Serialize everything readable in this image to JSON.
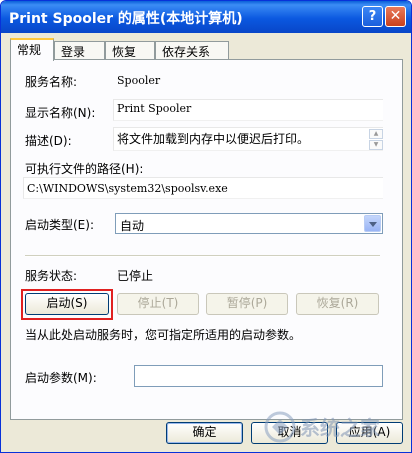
{
  "window": {
    "title": "Print Spooler 的属性(本地计算机)",
    "help_label": "?",
    "close_label": "✕"
  },
  "tabs": [
    {
      "label": "常规",
      "active": true
    },
    {
      "label": "登录",
      "active": false
    },
    {
      "label": "恢复",
      "active": false
    },
    {
      "label": "依存关系",
      "active": false
    }
  ],
  "general": {
    "service_name_label": "服务名称:",
    "service_name_value": "Spooler",
    "display_name_label": "显示名称(N):",
    "display_name_value": "Print Spooler",
    "description_label": "描述(D):",
    "description_value": "将文件加载到内存中以便迟后打印。",
    "exe_path_label": "可执行文件的路径(H):",
    "exe_path_value": "C:\\WINDOWS\\system32\\spoolsv.exe",
    "startup_type_label": "启动类型(E):",
    "startup_type_value": "自动",
    "service_status_label": "服务状态:",
    "service_status_value": "已停止",
    "start_button": "启动(S)",
    "stop_button": "停止(T)",
    "pause_button": "暂停(P)",
    "resume_button": "恢复(R)",
    "hint_text": "当从此处启动服务时，您可指定所适用的启动参数。",
    "start_params_label": "启动参数(M):",
    "start_params_value": ""
  },
  "footer": {
    "ok_button": "确定",
    "cancel_button": "取消",
    "apply_button": "应用(A)"
  },
  "watermark": {
    "text": "系统之家"
  },
  "colors": {
    "titlebar": "#0a5fd8",
    "highlight_box": "#e02020",
    "tab_active_accent": "#ffc83c"
  }
}
